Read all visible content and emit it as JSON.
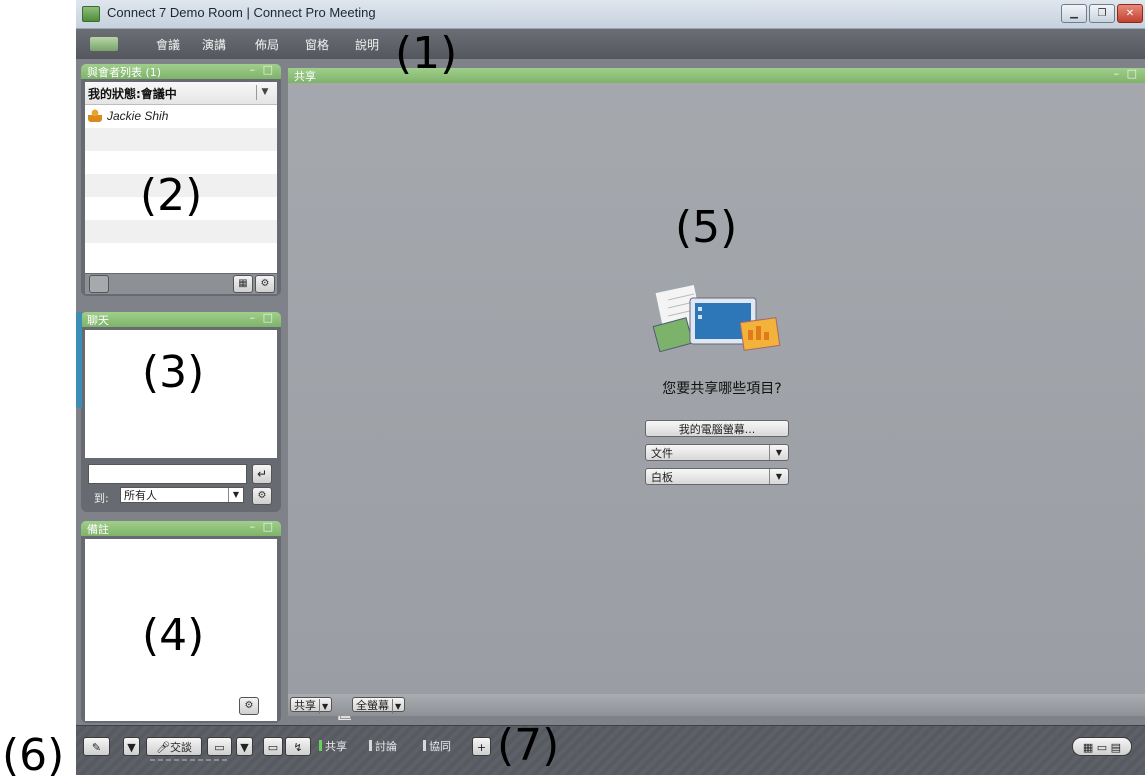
{
  "window": {
    "title": "Connect 7 Demo Room | Connect Pro Meeting",
    "controls": [
      "minimize",
      "restore",
      "close"
    ]
  },
  "menu": {
    "items": [
      "會議",
      "演講",
      "佈局",
      "窗格",
      "說明"
    ]
  },
  "attendees_pod": {
    "title": "與會者列表 (1)",
    "status": "我的狀態:會議中",
    "people": [
      "Jackie Shih"
    ]
  },
  "chat_pod": {
    "title": "聊天",
    "to_label": "到:",
    "to_value": "所有人"
  },
  "notes_pod": {
    "title": "備註"
  },
  "share_pod": {
    "title": "共享",
    "prompt": "您要共享哪些項目?",
    "option_screen": "我的電腦螢幕...",
    "option_document": "文件",
    "option_whiteboard": "白板",
    "footer_share": "共享",
    "footer_fullscreen": "全螢幕"
  },
  "bottombar": {
    "talk_label": "交談",
    "tabs": [
      {
        "label": "共享",
        "active": true
      },
      {
        "label": "討論",
        "active": false
      },
      {
        "label": "協同",
        "active": false
      }
    ],
    "add": "+"
  },
  "annotations": [
    "(1)",
    "(2)",
    "(3)",
    "(4)",
    "(5)",
    "(6)",
    "(7)"
  ],
  "colors": {
    "pod_header": "#8fc27a",
    "app_background": "#7f8389",
    "share_background": "#a1a5aa"
  }
}
